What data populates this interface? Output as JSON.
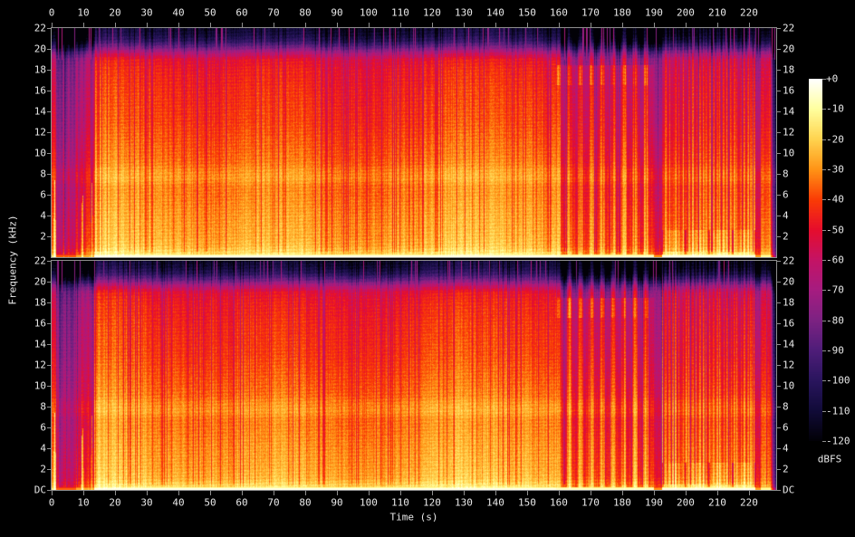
{
  "figure": {
    "type": "stereo-audio-spectrogram",
    "background": "#000000",
    "text_color": "#e9e9e9",
    "axis_color": "#8f8f8f"
  },
  "axes": {
    "x": {
      "label": "Time (s)",
      "min": 0,
      "max": 228.6,
      "ticks": [
        [
          0,
          "0"
        ],
        [
          10,
          "10"
        ],
        [
          20,
          "20"
        ],
        [
          30,
          "30"
        ],
        [
          40,
          "40"
        ],
        [
          50,
          "50"
        ],
        [
          60,
          "60"
        ],
        [
          70,
          "70"
        ],
        [
          80,
          "80"
        ],
        [
          90,
          "90"
        ],
        [
          100,
          "100"
        ],
        [
          110,
          "110"
        ],
        [
          120,
          "120"
        ],
        [
          130,
          "130"
        ],
        [
          140,
          "140"
        ],
        [
          150,
          "150"
        ],
        [
          160,
          "160"
        ],
        [
          170,
          "170"
        ],
        [
          180,
          "180"
        ],
        [
          190,
          "190"
        ],
        [
          200,
          "200"
        ],
        [
          210,
          "210"
        ],
        [
          220,
          "220"
        ]
      ]
    },
    "y": {
      "label": "Frequency (kHz)",
      "min": 0,
      "max": 22,
      "ticks": [
        [
          22,
          "22"
        ],
        [
          20,
          "20"
        ],
        [
          18,
          "18"
        ],
        [
          16,
          "16"
        ],
        [
          14,
          "14"
        ],
        [
          12,
          "12"
        ],
        [
          10,
          "10"
        ],
        [
          8,
          "8"
        ],
        [
          6,
          "6"
        ],
        [
          4,
          "4"
        ],
        [
          2,
          "2"
        ],
        [
          0,
          "DC"
        ]
      ]
    }
  },
  "colorbar": {
    "units": "dBFS",
    "min": -120,
    "max": 0,
    "ticks": [
      [
        0,
        "+0"
      ],
      [
        -10,
        "-10"
      ],
      [
        -20,
        "-20"
      ],
      [
        -30,
        "-30"
      ],
      [
        -40,
        "-40"
      ],
      [
        -50,
        "-50"
      ],
      [
        -60,
        "-60"
      ],
      [
        -70,
        "-70"
      ],
      [
        -80,
        "-80"
      ],
      [
        -90,
        "-90"
      ],
      [
        -100,
        "-100"
      ],
      [
        -110,
        "-110"
      ],
      [
        -120,
        "-120"
      ]
    ]
  },
  "chart_data": {
    "type": "heatmap",
    "subtype": "spectrogram",
    "channels": 2,
    "channel_note": "two nearly identical stereo channels stacked vertically",
    "duration_s": 228.6,
    "x": {
      "label": "Time (s)",
      "min": 0,
      "max": 228.6
    },
    "y": {
      "label": "Frequency (kHz)",
      "min": 0,
      "max": 22
    },
    "z": {
      "label": "dBFS",
      "min": -120,
      "max": 0
    },
    "palette": [
      [
        0,
        "#ffffff"
      ],
      [
        -10,
        "#ffff9e"
      ],
      [
        -20,
        "#ffd34f"
      ],
      [
        -30,
        "#ff9416"
      ],
      [
        -40,
        "#fa3c05"
      ],
      [
        -50,
        "#e60d2d"
      ],
      [
        -60,
        "#c41365"
      ],
      [
        -70,
        "#a61c80"
      ],
      [
        -80,
        "#7d2282"
      ],
      [
        -90,
        "#4f1d79"
      ],
      [
        -100,
        "#2a155e"
      ],
      [
        -110,
        "#110b39"
      ],
      [
        -120,
        "#020107"
      ]
    ],
    "timeline_segments": [
      {
        "start": 0,
        "end": 1.3,
        "name": "opening-hit",
        "level_db": -44
      },
      {
        "start": 1.3,
        "end": 7.5,
        "name": "quiet-intro",
        "level_db": -66
      },
      {
        "start": 7.5,
        "end": 13.2,
        "name": "intro-build",
        "level_db": -56
      },
      {
        "start": 13.2,
        "end": 159,
        "name": "main-body",
        "level_db": -33
      },
      {
        "start": 159,
        "end": 190,
        "name": "breakdown",
        "level_db": -36
      },
      {
        "start": 190,
        "end": 192.5,
        "name": "quiet-gap",
        "level_db": -60
      },
      {
        "start": 192.5,
        "end": 222,
        "name": "final-chorus",
        "level_db": -33
      },
      {
        "start": 222,
        "end": 223.5,
        "name": "pre-outro-gap",
        "level_db": -58
      },
      {
        "start": 223.5,
        "end": 226.8,
        "name": "outro-hit",
        "level_db": -40
      },
      {
        "start": 226.8,
        "end": 228.6,
        "name": "fade-out",
        "level_db": -85
      }
    ],
    "freq_profile_db": [
      [
        0,
        24
      ],
      [
        0.3,
        17
      ],
      [
        1,
        10
      ],
      [
        2,
        7.5
      ],
      [
        4,
        5
      ],
      [
        6,
        2
      ],
      [
        6.8,
        2
      ],
      [
        7.5,
        6
      ],
      [
        8.3,
        4
      ],
      [
        9,
        0
      ],
      [
        10,
        -2
      ],
      [
        13,
        -7
      ],
      [
        16,
        -10
      ],
      [
        18,
        -13
      ],
      [
        19,
        -17
      ],
      [
        19.6,
        -30
      ],
      [
        20.2,
        -50
      ],
      [
        20.8,
        -66
      ],
      [
        21.4,
        -74
      ],
      [
        22,
        -78
      ]
    ],
    "intro_transients_s": [
      0.85,
      9.6,
      12.6
    ],
    "features": [
      {
        "name": "dc-line",
        "description": "bright yellow-white line at 0 kHz along the bottom of each channel"
      },
      {
        "name": "hf-transient-spikes",
        "description": "thin vertical blue/purple transient lines reaching 20-22 kHz throughout"
      },
      {
        "name": "beat-stripes",
        "description": "narrow dark vertical stripes from beats across the whole band"
      },
      {
        "name": "bright-band",
        "freq_khz": [
          6.8,
          8.3
        ],
        "description": "brighter orange horizontal band near 7-8 kHz"
      },
      {
        "name": "breakdown-hotspots",
        "time_s": [
          161,
          188
        ],
        "freq_khz": [
          16.5,
          18.5
        ],
        "description": "bright orange patches near 17 kHz during the breakdown, periodic ~3.4 s"
      },
      {
        "name": "bass-scallops",
        "time_s": [
          193,
          222
        ],
        "description": "scalloped bright yellow bass arcs with ~7 s period"
      }
    ]
  }
}
